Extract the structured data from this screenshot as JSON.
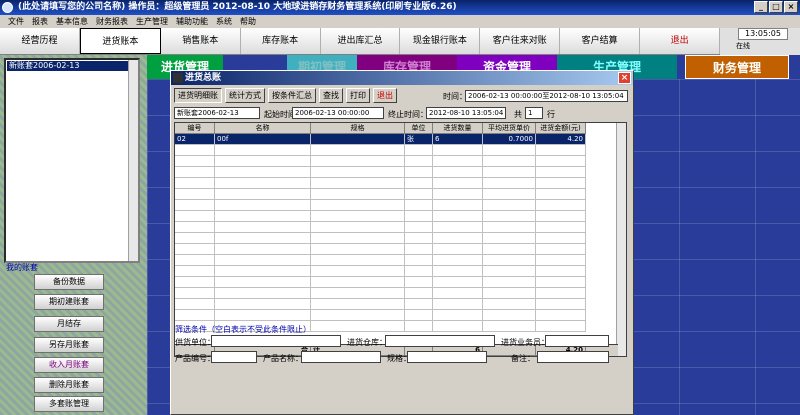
{
  "window": {
    "title": "(此处请填写您的公司名称)   操作员：超级管理员   2012-08-10   大地球进销存财务管理系统(印刷专业版6.26)",
    "min": "_",
    "max": "□",
    "close": "×"
  },
  "menu": [
    "文件",
    "报表",
    "基本信息",
    "财务报表",
    "生产管理",
    "辅助功能",
    "系统",
    "帮助"
  ],
  "nav": [
    "经营历程",
    "进货账本",
    "销售账本",
    "库存账本",
    "进出库汇总",
    "现金银行账本",
    "客户往来对账",
    "客户结算",
    "退出"
  ],
  "clock": "13:05:05",
  "status_label": "在线",
  "account_list": {
    "items": [
      "新账套2006-02-13"
    ],
    "label": "我的账套"
  },
  "sidebar_buttons": [
    "备份数据",
    "期初建账套",
    "月结存",
    "另存月账套",
    "收入月账套",
    "删除月账套",
    "多套账管理"
  ],
  "tiles": [
    {
      "label": "进货管理",
      "color": "#00a040",
      "text": "#ffffff"
    },
    {
      "label": "期初管理",
      "color": "#40b0c0",
      "text": "#80c0c0"
    },
    {
      "label": "库存管理",
      "color": "#800080",
      "text": "#d080d0"
    },
    {
      "label": "资金管理",
      "color": "#8000c0",
      "text": "#ffffff"
    },
    {
      "label": "生产管理",
      "color": "#008080",
      "text": "#80ffff"
    },
    {
      "label": "财务管理",
      "color": "#c06000",
      "text": "#ffffff"
    }
  ],
  "dialog": {
    "title": "进货总账",
    "close": "×",
    "toolbar": [
      "进货明细账",
      "统计方式",
      "按条件汇总",
      "查找",
      "打印",
      "退出"
    ],
    "time_label": "时间：",
    "time_value": "2006-02-13 00:00:00至2012-08-10 13:05:04",
    "account_name": "新账套2006-02-13",
    "start_label": "起始时间：",
    "start_value": "2006-02-13 00:00:00",
    "end_label": "终止时间：",
    "end_value": "2012-08-10 13:05:04",
    "total_label": "共",
    "total_value": "1",
    "rows_unit": "行",
    "table": {
      "headers": [
        "编号",
        "名称",
        "规格",
        "单位",
        "进货数量",
        "平均进货单价",
        "进货金额(元)"
      ],
      "rows": [
        [
          "02",
          "00f",
          "",
          "张",
          "6",
          "0.7000",
          "4.20"
        ]
      ],
      "footer": {
        "c1": "合",
        "c2": "计",
        "qty": "6",
        "amount": "4.20"
      }
    },
    "filter": {
      "title": "筛选条件（空白表示不受此条件限止）",
      "supplier_label": "供货单位：",
      "warehouse_label": "进货仓库：",
      "clerk_label": "进货业务员：",
      "code_label": "产品编号：",
      "name_label": "产品名称：",
      "spec_label": "规格：",
      "note_label": "备注："
    }
  }
}
